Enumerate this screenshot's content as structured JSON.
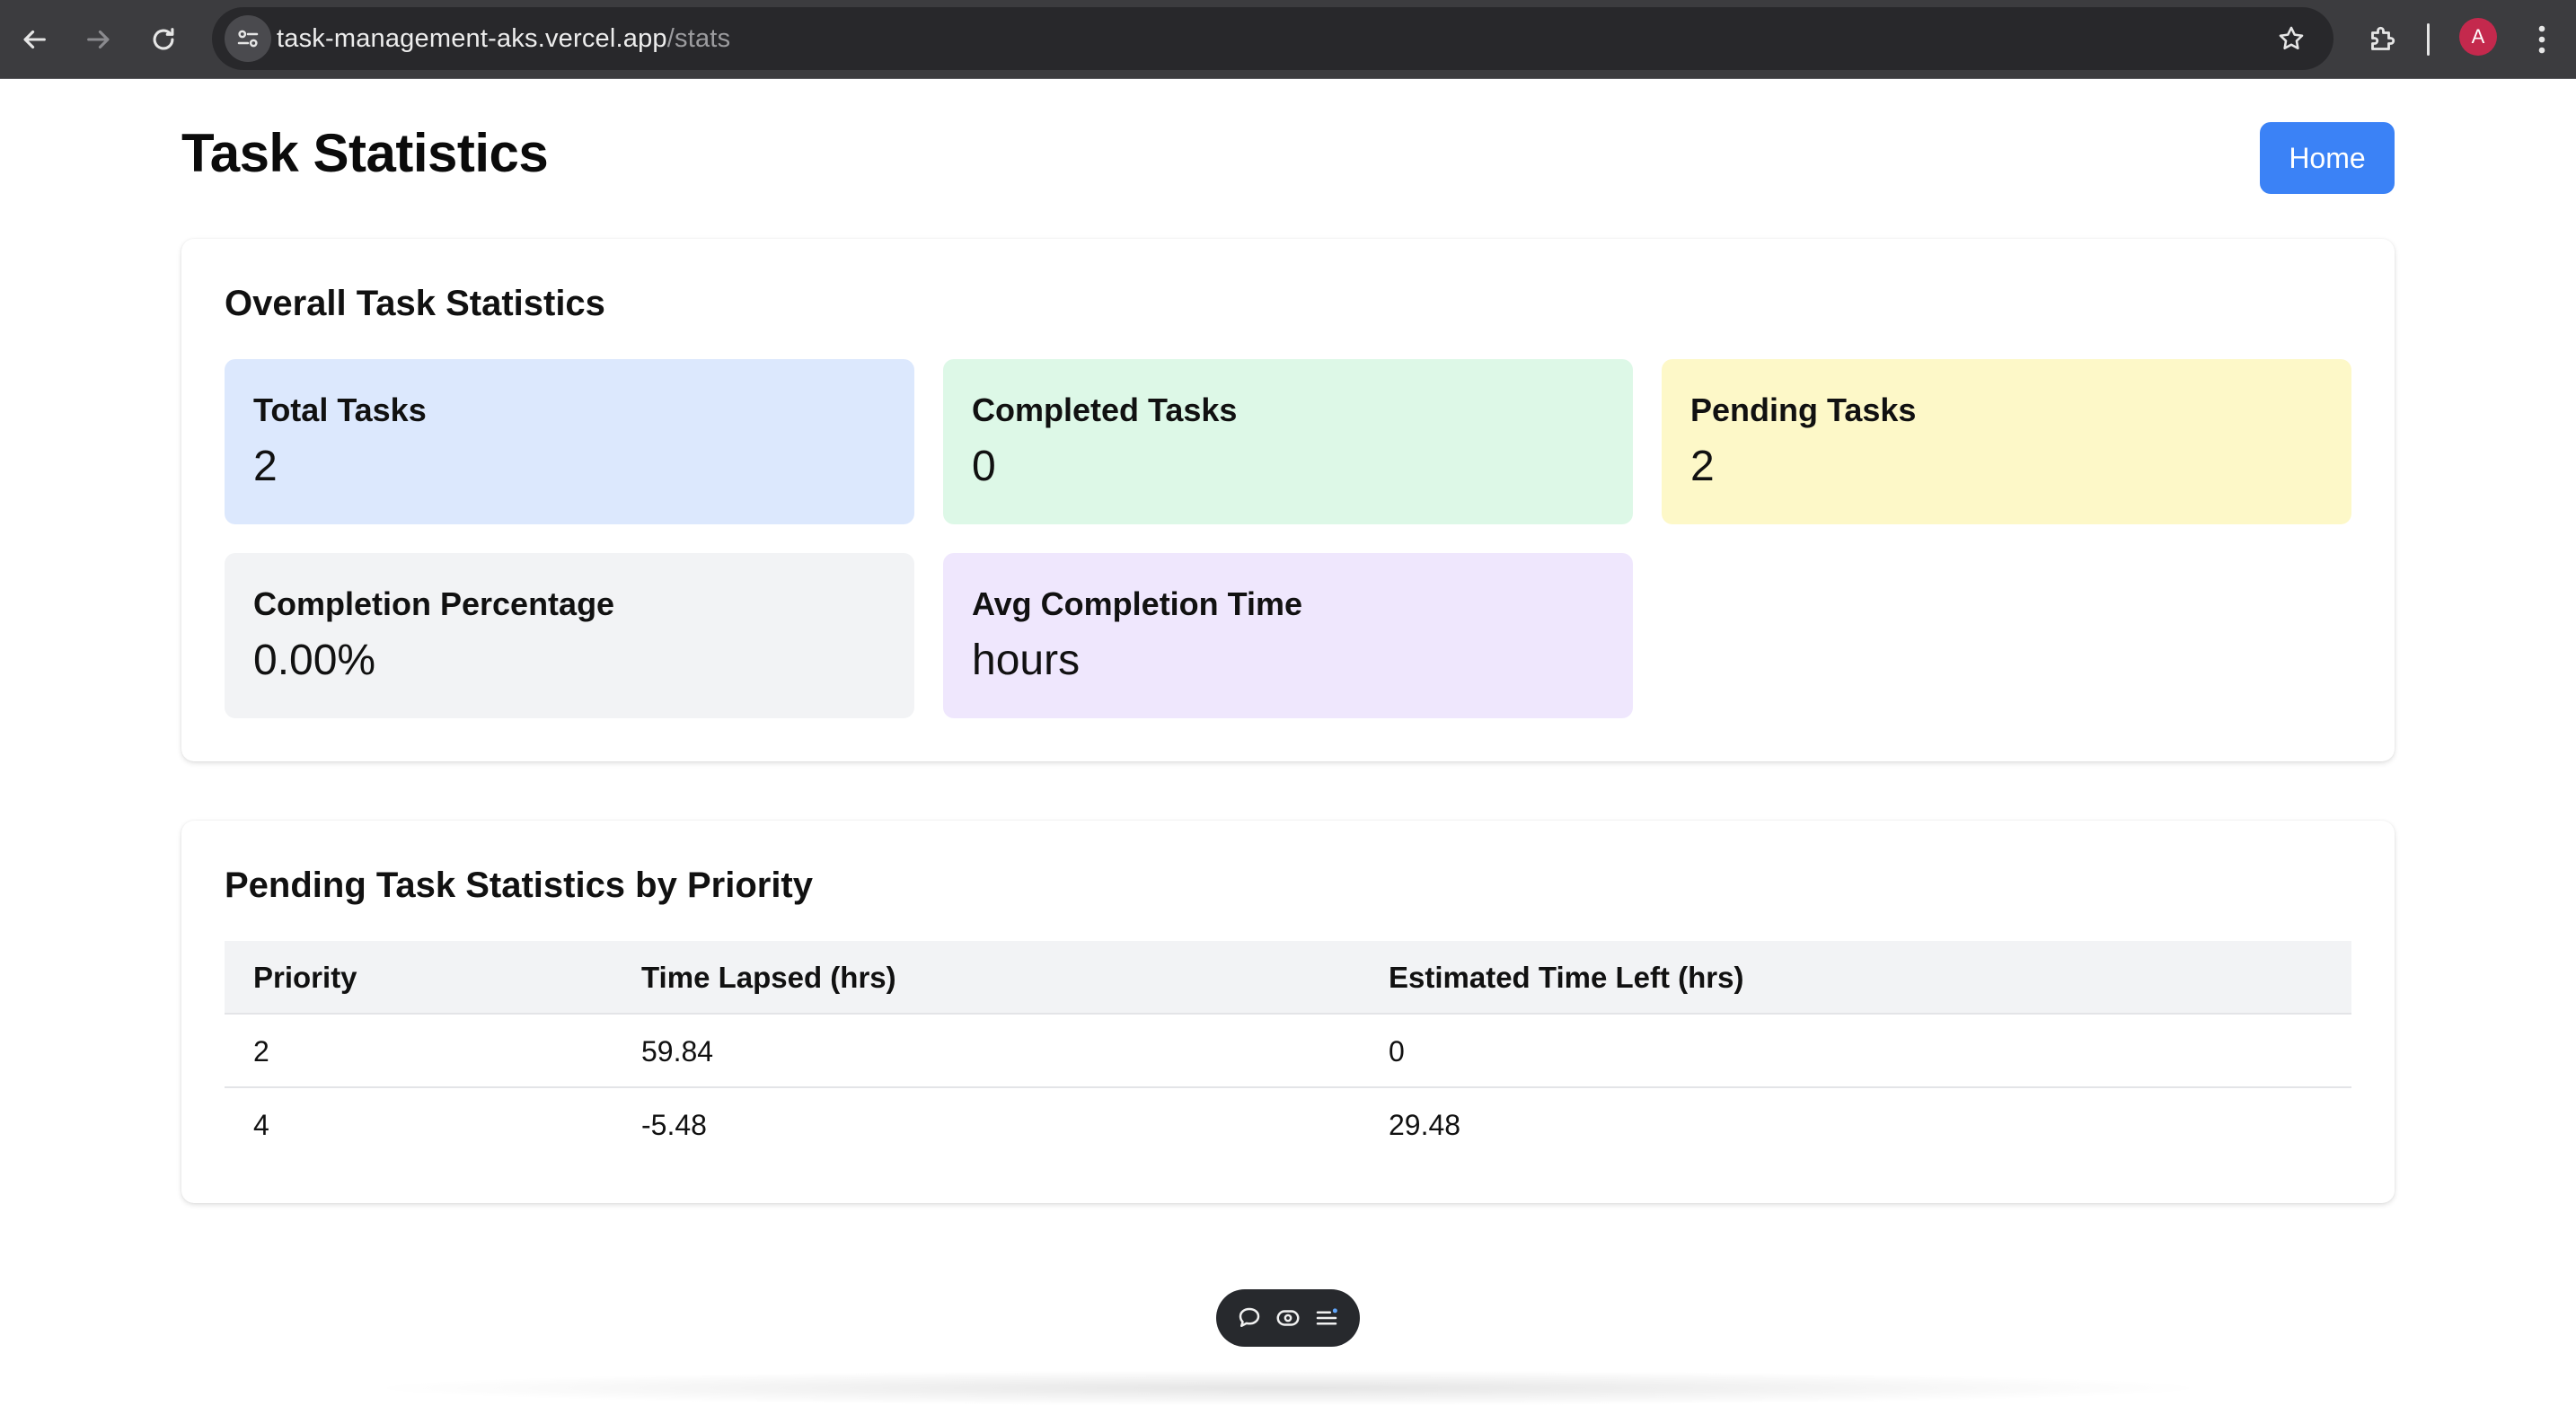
{
  "browser": {
    "url_host": "task-management-aks.vercel.app",
    "url_path": "/stats",
    "profile_initial": "A"
  },
  "page": {
    "title": "Task Statistics",
    "home_label": "Home"
  },
  "overall": {
    "title": "Overall Task Statistics",
    "stats": {
      "total": {
        "label": "Total Tasks",
        "value": "2",
        "color": "#dce8fd"
      },
      "completed": {
        "label": "Completed Tasks",
        "value": "0",
        "color": "#ddf8e7"
      },
      "pending": {
        "label": "Pending Tasks",
        "value": "2",
        "color": "#fdf8c8"
      },
      "percentage": {
        "label": "Completion Percentage",
        "value": "0.00%",
        "color": "#f2f3f5"
      },
      "avg": {
        "label": "Avg Completion Time",
        "value": "hours",
        "color": "#efe7fd"
      }
    }
  },
  "pending_by_priority": {
    "title": "Pending Task Statistics by Priority",
    "columns": [
      "Priority",
      "Time Lapsed (hrs)",
      "Estimated Time Left (hrs)"
    ],
    "rows": [
      [
        "2",
        "59.84",
        "0"
      ],
      [
        "4",
        "-5.48",
        "29.48"
      ]
    ]
  },
  "colors": {
    "accent": "#3b82f6",
    "chrome_bg": "#3c3c3f",
    "avatar": "#c4294d"
  }
}
